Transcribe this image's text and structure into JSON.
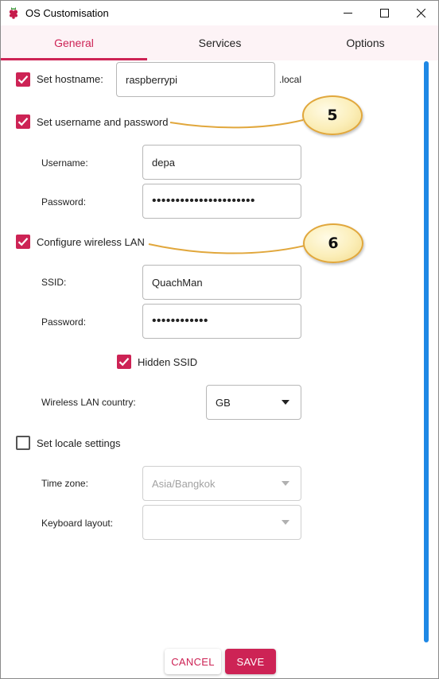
{
  "window": {
    "title": "OS Customisation"
  },
  "tabs": [
    {
      "label": "General"
    },
    {
      "label": "Services"
    },
    {
      "label": "Options"
    }
  ],
  "hostname": {
    "label": "Set hostname:",
    "checked": true,
    "value": "raspberrypi",
    "suffix": ".local"
  },
  "user": {
    "label": "Set username and password",
    "checked": true,
    "username_label": "Username:",
    "username_value": "depa",
    "password_label": "Password:",
    "password_value": "••••••••••••••••••••••"
  },
  "wifi": {
    "label": "Configure wireless LAN",
    "checked": true,
    "ssid_label": "SSID:",
    "ssid_value": "QuachMan",
    "password_label": "Password:",
    "password_value": "••••••••••••",
    "hidden_label": "Hidden SSID",
    "hidden_checked": true,
    "country_label": "Wireless LAN country:",
    "country_value": "GB"
  },
  "locale": {
    "label": "Set locale settings",
    "checked": false,
    "timezone_label": "Time zone:",
    "timezone_value": "Asia/Bangkok",
    "keyboard_label": "Keyboard layout:",
    "keyboard_value": ""
  },
  "annotations": {
    "first": "5",
    "second": "6"
  },
  "footer": {
    "cancel_label": "CANCEL",
    "save_label": "SAVE"
  },
  "colors": {
    "accent": "#cd2355",
    "scrollbar": "#1e88e5",
    "tab_background": "#fdf3f6",
    "callout_border": "#e1a73c"
  }
}
